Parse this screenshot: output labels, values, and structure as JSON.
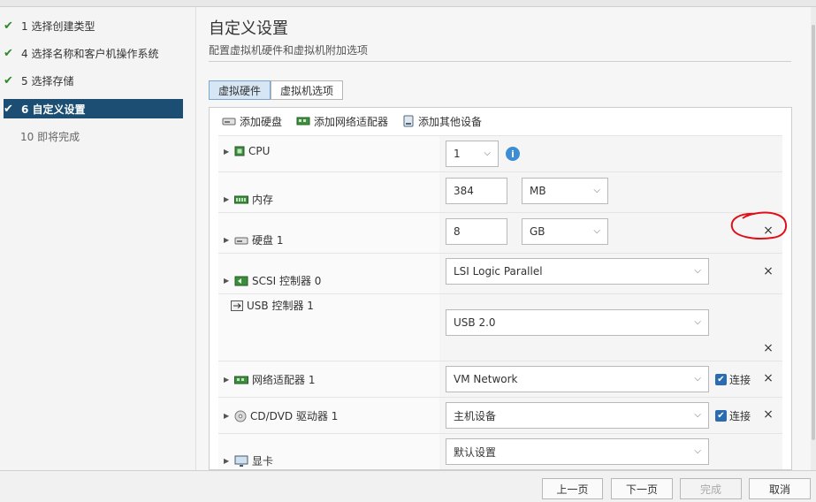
{
  "steps": [
    {
      "label": "1 选择创建类型",
      "done": true
    },
    {
      "label": "4 选择名称和客户机操作系统",
      "done": true
    },
    {
      "label": "5 选择存储",
      "done": true
    },
    {
      "label": "6 自定义设置",
      "done": true,
      "active": true
    },
    {
      "label": "10 即将完成",
      "done": false
    }
  ],
  "main": {
    "title": "自定义设置",
    "subtitle": "配置虚拟机硬件和虚拟机附加选项",
    "tabs": [
      "虚拟硬件",
      "虚拟机选项"
    ]
  },
  "toolbar": {
    "add_disk": "添加硬盘",
    "add_nic": "添加网络适配器",
    "add_other": "添加其他设备"
  },
  "hardware": {
    "cpu": {
      "label": "CPU",
      "value": "1"
    },
    "memory": {
      "label": "内存",
      "value": "384",
      "unit": "MB"
    },
    "disk": {
      "label": "硬盘 1",
      "value": "8",
      "unit": "GB"
    },
    "scsi": {
      "label": "SCSI 控制器 0",
      "value": "LSI Logic Parallel"
    },
    "usb": {
      "label": "USB 控制器 1",
      "value": "USB 2.0"
    },
    "nic": {
      "label": "网络适配器 1",
      "value": "VM Network",
      "connect": "连接"
    },
    "cdrom": {
      "label": "CD/DVD 驱动器 1",
      "value": "主机设备",
      "connect": "连接"
    },
    "video": {
      "label": "显卡",
      "value": "默认设置"
    }
  },
  "icons": {
    "check": "✔",
    "close": "×",
    "chevron": "⌵",
    "caret": "▶",
    "info": "i"
  },
  "buttons": {
    "prev": "上一页",
    "next": "下一页",
    "finish": "完成",
    "cancel": "取消"
  },
  "colors": {
    "active_step": "#1b4e72",
    "check_green": "#2b8a2b",
    "annotation_red": "#e0101a",
    "info_blue": "#3c8dd4"
  }
}
